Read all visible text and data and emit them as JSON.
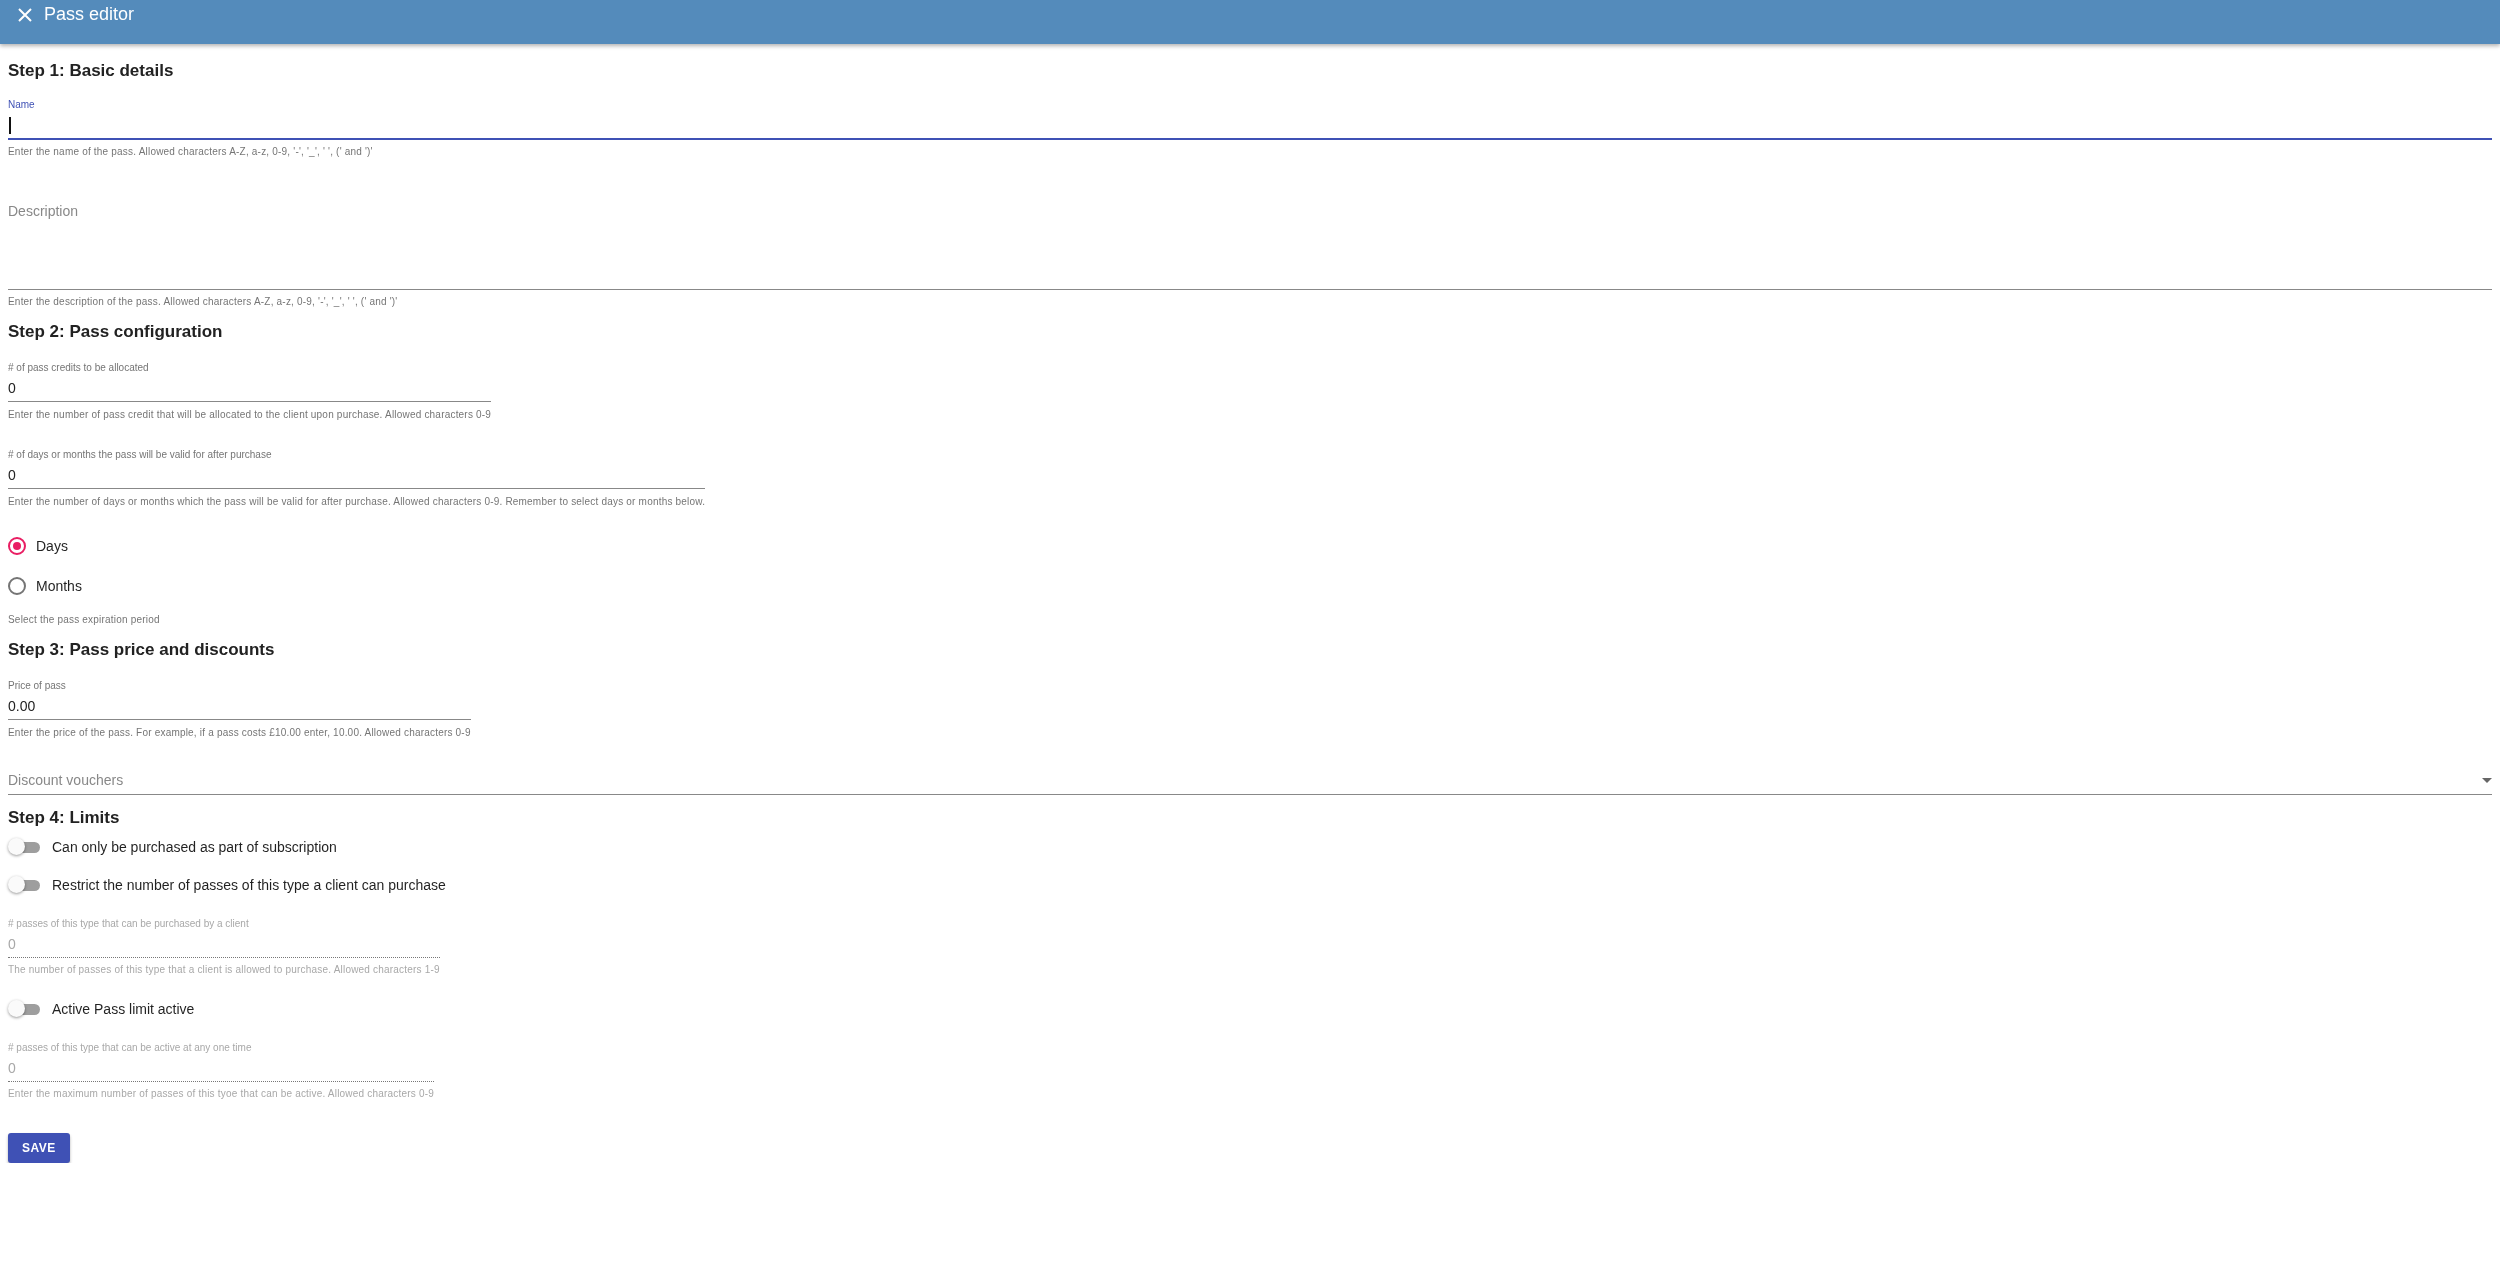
{
  "header": {
    "title": "Pass editor"
  },
  "sections": [
    {
      "heading": "Step 1: Basic details",
      "items": [
        {
          "kind": "text",
          "label": "Name",
          "value": "",
          "focused": true,
          "helper": "Enter the name of the pass. Allowed characters A-Z, a-z, 0-9, '-', '_', ' ', (' and ')'"
        },
        {
          "kind": "textarea",
          "placeholder": "Description",
          "helper": "Enter the description of the pass. Allowed characters A-Z, a-z, 0-9, '-', '_', ' ', (' and ')'"
        }
      ]
    },
    {
      "heading": "Step 2: Pass configuration",
      "items": [
        {
          "kind": "number",
          "label": "# of pass credits to be allocated",
          "value": "0",
          "helper": "Enter the number of pass credit that will be allocated to the client upon purchase. Allowed characters 0-9"
        },
        {
          "kind": "number",
          "label": "# of days or months the pass will be valid for after purchase",
          "value": "0",
          "helper": "Enter the number of days or months which the pass will be valid for after purchase. Allowed characters 0-9. Remember to select days or months below."
        },
        {
          "kind": "radio-group",
          "options": [
            {
              "label": "Days",
              "selected": true
            },
            {
              "label": "Months",
              "selected": false
            }
          ],
          "helper": "Select the pass expiration period"
        }
      ]
    },
    {
      "heading": "Step 3: Pass price and discounts",
      "items": [
        {
          "kind": "number",
          "label": "Price of pass",
          "value": "0.00",
          "helper": "Enter the price of the pass. For example, if a pass costs £10.00 enter, 10.00. Allowed characters 0-9"
        },
        {
          "kind": "select",
          "placeholder": "Discount vouchers"
        }
      ]
    },
    {
      "heading": "Step 4: Limits",
      "items": [
        {
          "kind": "switch",
          "label": "Can only be purchased as part of subscription",
          "on": false
        },
        {
          "kind": "switch",
          "label": "Restrict the number of passes of this type a client can purchase",
          "on": false
        },
        {
          "kind": "number",
          "label": "# passes of this type that can be purchased by a client",
          "value": "0",
          "disabled": true,
          "helper": "The number of passes of this type that a client is allowed to purchase. Allowed characters 1-9"
        },
        {
          "kind": "switch",
          "label": "Active Pass limit active",
          "on": false
        },
        {
          "kind": "number",
          "label": "# passes of this type that can be active at any one time",
          "value": "0",
          "disabled": true,
          "helper": "Enter the maximum number of passes of this tyoe that can be active. Allowed characters 0-9"
        }
      ]
    }
  ],
  "save_button": "SAVE"
}
